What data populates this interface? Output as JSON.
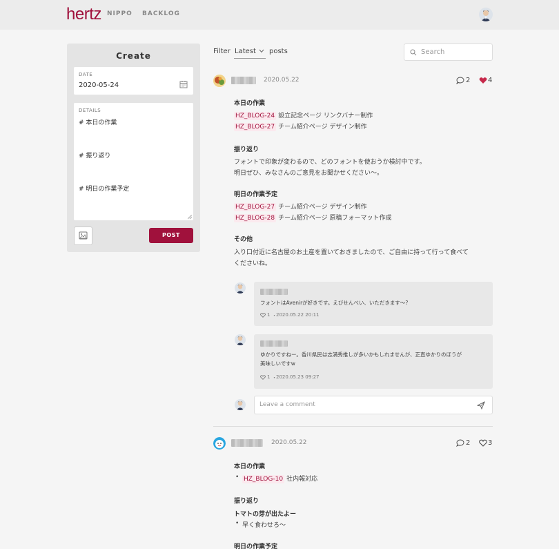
{
  "app": {
    "logo": "hertz",
    "accent": "#a0113c"
  },
  "nav": {
    "items": [
      "NIPPO",
      "BACKLOG"
    ]
  },
  "create": {
    "title": "Create",
    "date_label": "DATE",
    "date_value": "2020-05-24",
    "details_label": "DETAILS",
    "details_lines": [
      "# 本日の作業",
      "# 振り返り",
      "# 明日の作業予定"
    ],
    "post_label": "POST"
  },
  "filter": {
    "label": "Filter",
    "selected": "Latest",
    "suffix": "posts"
  },
  "search": {
    "placeholder": "Search"
  },
  "posts": [
    {
      "date": "2020.05.22",
      "comments": "2",
      "likes": "4",
      "sections": [
        {
          "title": "本日の作業",
          "tasks": [
            {
              "tag": "HZ_BLOG-24",
              "text": "設立記念ページ リンクバナー制作"
            },
            {
              "tag": "HZ_BLOG-27",
              "text": "チーム紹介ページ デザイン制作"
            }
          ]
        },
        {
          "title": "振り返り",
          "lines": [
            "フォントで印象が変わるので、どのフォントを使おうか検討中です。",
            "明日ぜひ、みなさんのご意見をお聞かせください〜。"
          ]
        },
        {
          "title": "明日の作業予定",
          "tasks": [
            {
              "tag": "HZ_BLOG-27",
              "text": "チーム紹介ページ デザイン制作"
            },
            {
              "tag": "HZ_BLOG-28",
              "text": "チーム紹介ページ 原稿フォーマット作成"
            }
          ]
        },
        {
          "title": "その他",
          "lines": [
            "入り口付近に名古屋のお土産を置いておきましたので、ご自由に持って行って食べて",
            "くださいね。"
          ]
        }
      ],
      "thread": [
        {
          "lines": [
            "フォントはAvenirが好きです。えびせんべい、いただきます〜?"
          ],
          "likes": "1",
          "date": "2020.05.22 20:11"
        },
        {
          "lines": [
            "ゆかりですねー。香川県民は志満秀推しが多いかもしれませんが、正直ゆかりのほうが",
            "美味しいですw"
          ],
          "likes": "1",
          "date": "2020.05.23 09:27"
        }
      ],
      "comment_placeholder": "Leave a comment"
    },
    {
      "date": "2020.05.22",
      "comments": "2",
      "likes": "3",
      "sections": [
        {
          "title": "本日の作業",
          "tag": "HZ_BLOG-10",
          "text": "社内報対応"
        },
        {
          "title": "振り返り",
          "bold": "トマトの芽が出たよー",
          "bullet": "早く食わせろ〜"
        },
        {
          "title": "明日の作業予定"
        }
      ]
    }
  ]
}
